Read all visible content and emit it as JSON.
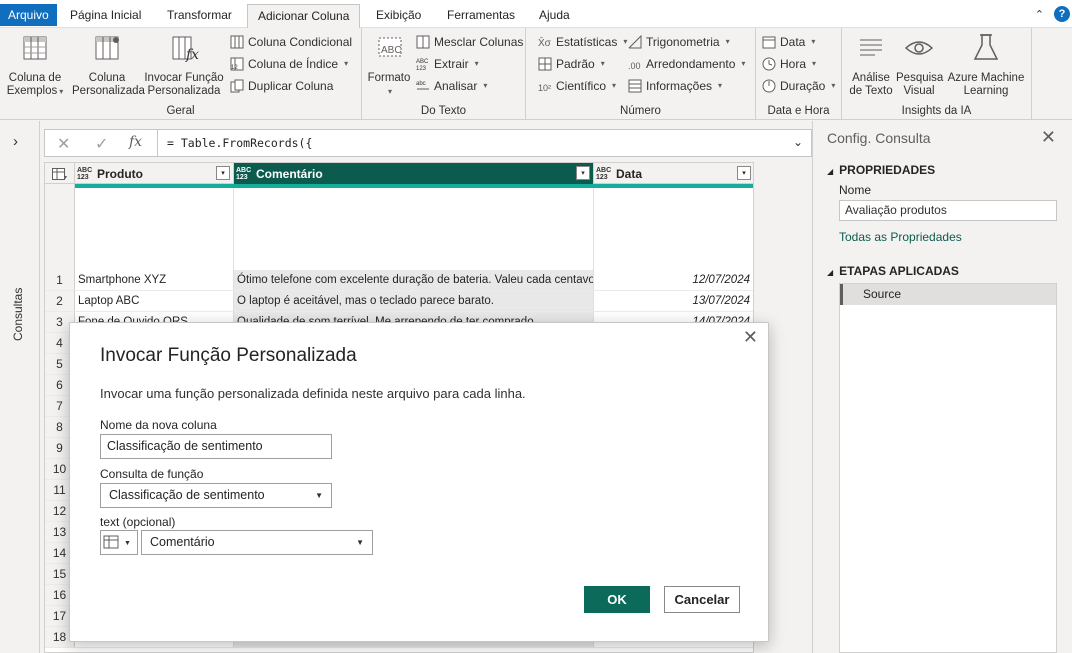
{
  "menu": {
    "tabs": [
      "Arquivo",
      "Página Inicial",
      "Transformar",
      "Adicionar Coluna",
      "Exibição",
      "Ferramentas",
      "Ajuda"
    ],
    "active": "Adicionar Coluna",
    "help": "?"
  },
  "ribbon": {
    "geral": {
      "title": "Geral",
      "col_exemplos": "Coluna de Exemplos",
      "col_personalizada": "Coluna Personalizada",
      "invocar": "Invocar Função Personalizada",
      "col_condicional": "Coluna Condicional",
      "col_indice": "Coluna de Índice",
      "duplicar": "Duplicar Coluna"
    },
    "texto": {
      "title": "Do Texto",
      "formato": "Formato",
      "mesclar": "Mesclar Colunas",
      "extrair": "Extrair",
      "analisar": "Analisar"
    },
    "numero": {
      "title": "Número",
      "estatisticas": "Estatísticas",
      "padrao": "Padrão",
      "cientifico": "Científico",
      "trigonometria": "Trigonometria",
      "arredondamento": "Arredondamento",
      "informacoes": "Informações"
    },
    "data_hora": {
      "title": "Data e Hora",
      "data": "Data",
      "hora": "Hora",
      "duracao": "Duração"
    },
    "ia": {
      "title": "Insights da IA",
      "analise": "Análise de Texto",
      "pesquisa": "Pesquisa Visual",
      "azure": "Azure Machine Learning"
    }
  },
  "left_pane": {
    "label": "Consultas"
  },
  "formula": {
    "text": "= Table.FromRecords({"
  },
  "grid": {
    "columns": [
      {
        "type": "ABC\n123",
        "name": "Produto"
      },
      {
        "type": "ABC\n123",
        "name": "Comentário"
      },
      {
        "type": "ABC\n123",
        "name": "Data"
      }
    ],
    "rows": [
      {
        "n": "1",
        "produto": "Smartphone XYZ",
        "comentario": "Ótimo telefone com excelente duração de bateria. Valeu cada centavo!",
        "data": "12/07/2024"
      },
      {
        "n": "2",
        "produto": "Laptop ABC",
        "comentario": "O laptop é aceitável, mas o teclado parece barato.",
        "data": "13/07/2024"
      },
      {
        "n": "3",
        "produto": "Fone de Ouvido QRS",
        "comentario": "Qualidade de som terrível. Me arrependo de ter comprado.",
        "data": "14/07/2024"
      }
    ],
    "row_numbers": [
      "4",
      "5",
      "6",
      "7",
      "8",
      "9",
      "10",
      "11",
      "12",
      "13",
      "14",
      "15",
      "16",
      "17",
      "18"
    ]
  },
  "query_settings": {
    "title": "Config. Consulta",
    "properties": "PROPRIEDADES",
    "name_label": "Nome",
    "name_value": "Avaliação produtos",
    "all_props": "Todas as Propriedades",
    "steps_title": "ETAPAS APLICADAS",
    "steps": [
      "Source"
    ]
  },
  "dialog": {
    "title": "Invocar Função Personalizada",
    "description": "Invocar uma função personalizada definida neste arquivo para cada linha.",
    "new_col_label": "Nome da nova coluna",
    "new_col_value": "Classificação de sentimento",
    "func_label": "Consulta de função",
    "func_value": "Classificação de sentimento",
    "param_label": "text (opcional)",
    "param_value": "Comentário",
    "ok": "OK",
    "cancel": "Cancelar"
  },
  "colors": {
    "accent": "#0b5b4f",
    "file_tab": "#106ebe",
    "quality": "#14ae9b"
  }
}
